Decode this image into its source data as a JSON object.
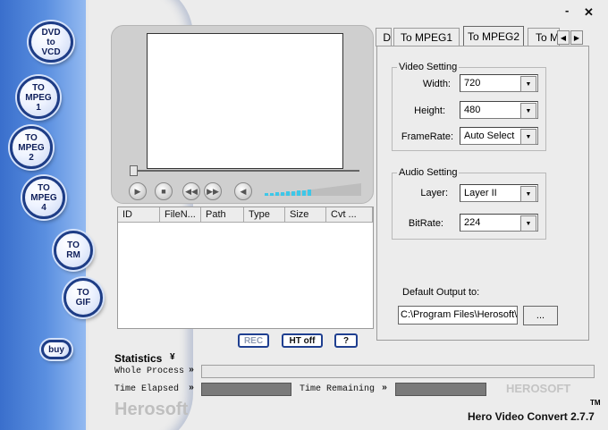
{
  "window": {
    "minimize_label": "-",
    "close_label": "✕"
  },
  "sidebar": {
    "buttons": [
      {
        "id": "dvd-to-vcd",
        "label": "DVD\nto\nVCD"
      },
      {
        "id": "to-mpeg1",
        "label": "TO\nMPEG\n1"
      },
      {
        "id": "to-mpeg2",
        "label": "TO\nMPEG\n2"
      },
      {
        "id": "to-mpeg4",
        "label": "TO\nMPEG\n4"
      },
      {
        "id": "to-rm",
        "label": "TO\nRM"
      },
      {
        "id": "to-gif",
        "label": "TO\nGIF"
      },
      {
        "id": "buy",
        "label": "buy"
      }
    ]
  },
  "player": {
    "icons": [
      "play-icon",
      "stop-icon",
      "rewind-icon",
      "fast-forward-icon",
      "volume-icon"
    ],
    "seek_position": 0
  },
  "file_list": {
    "columns": [
      "ID",
      "FileN...",
      "Path",
      "Type",
      "Size",
      "Cvt ..."
    ],
    "rows": []
  },
  "buttons": {
    "rec": "REC",
    "ht_off": "HT off",
    "help": "?"
  },
  "tabs": {
    "items": [
      "D",
      "To MPEG1",
      "To MPEG2",
      "To M"
    ],
    "active": "To MPEG2",
    "scroll_left": "◀",
    "scroll_right": "▶"
  },
  "video_setting": {
    "title": "Video Setting",
    "width_label": "Width:",
    "width_value": "720",
    "height_label": "Height:",
    "height_value": "480",
    "framerate_label": "FrameRate:",
    "framerate_value": "Auto Select"
  },
  "audio_setting": {
    "title": "Audio Setting",
    "layer_label": "Layer:",
    "layer_value": "Layer II",
    "bitrate_label": "BitRate:",
    "bitrate_value": "224"
  },
  "output": {
    "label": "Default Output to:",
    "path": "C:\\Program Files\\Herosoft\\",
    "browse_label": "..."
  },
  "statistics": {
    "title": "Statistics",
    "toggle": "¥",
    "whole_process_label": "Whole Process",
    "time_elapsed_label": "Time Elapsed",
    "time_remaining_label": "Time Remaining",
    "arrow": "»"
  },
  "branding": {
    "herosoft_left": "Herosoft",
    "herosoft_right": "HEROSOFT",
    "tm": "TM",
    "product": "Hero Video Convert 2.7.7"
  },
  "colors": {
    "sidebar_blue": "#3a6fcc",
    "button_border": "#1e3d86",
    "volume_cyan": "#3ec7e8"
  }
}
